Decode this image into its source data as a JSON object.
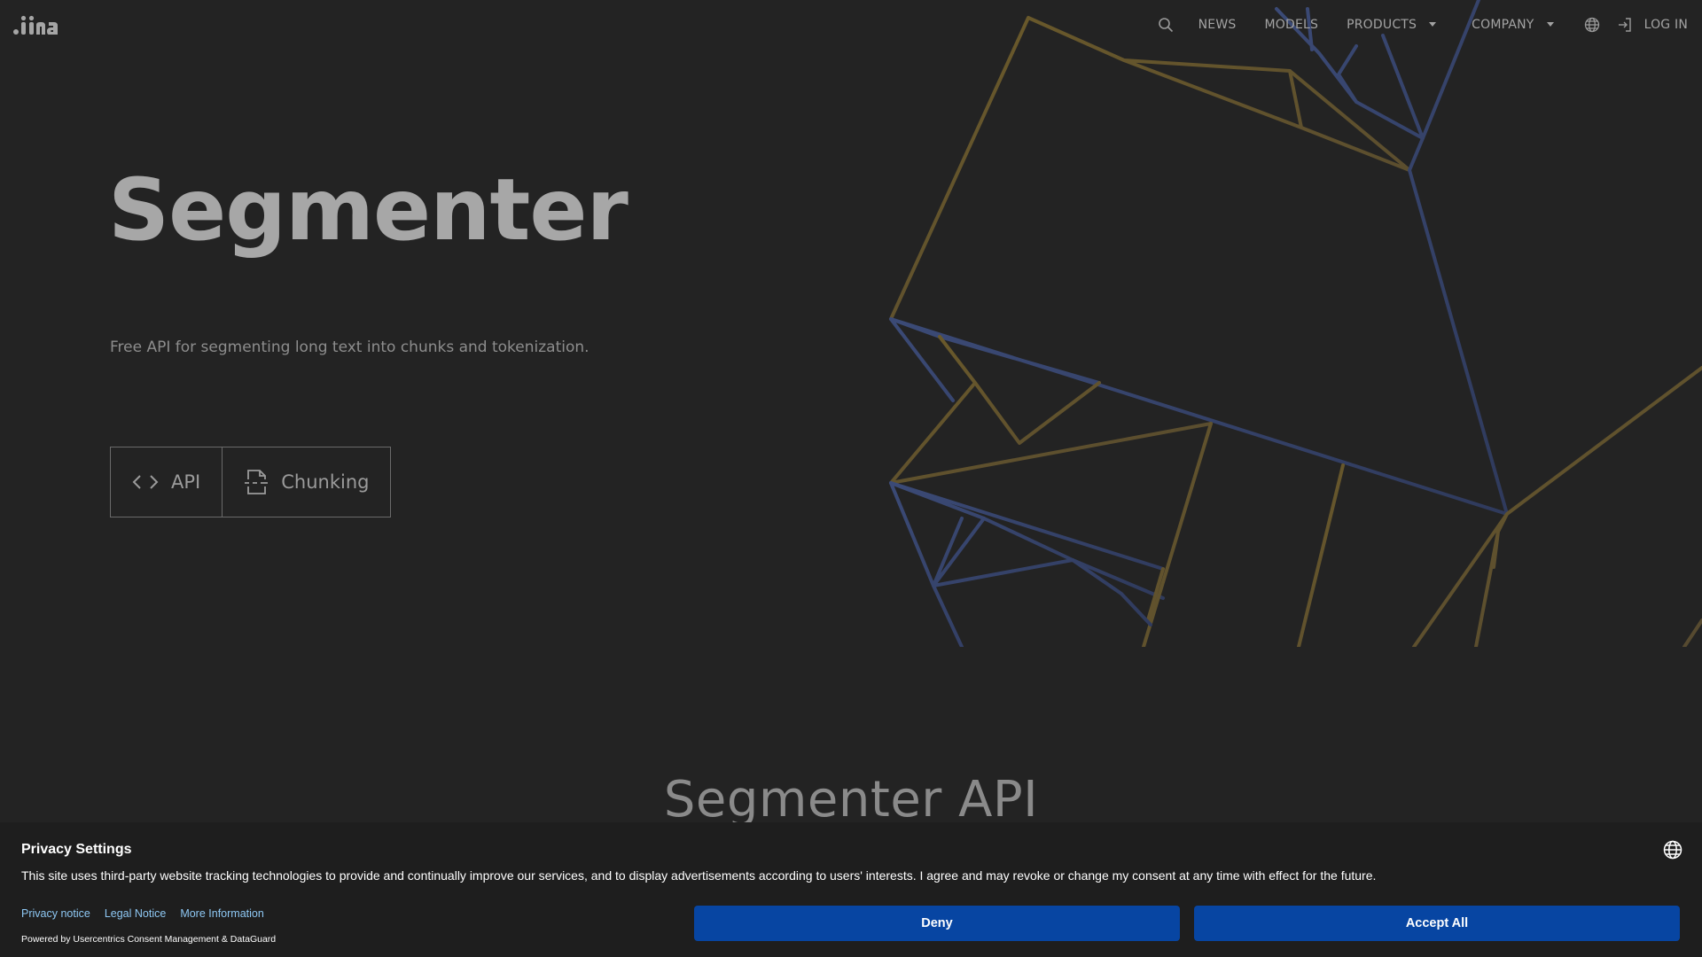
{
  "nav": {
    "links": {
      "news": "NEWS",
      "models": "MODELS",
      "products": "PRODUCTS",
      "company": "COMPANY",
      "login": "LOG IN"
    },
    "icons": [
      "search-icon",
      "globe-icon",
      "login-icon"
    ]
  },
  "hero": {
    "title": "Segmenter",
    "subtitle": "Free API for segmenting long text into chunks and tokenization.",
    "buttons": {
      "api": "API",
      "chunking": "Chunking"
    }
  },
  "section": {
    "title": "Segmenter API"
  },
  "consent": {
    "title": "Privacy Settings",
    "text": "This site uses third-party website tracking technologies to provide and continually improve our services, and to display advertisements according to users' interests. I agree and may revoke or change my consent at any time with effect for the future.",
    "links": {
      "privacy": "Privacy notice",
      "legal": "Legal Notice",
      "more": "More Information"
    },
    "powered_by": "Powered by Usercentrics Consent Management & DataGuard",
    "deny": "Deny",
    "accept": "Accept All"
  },
  "colors": {
    "background": "#232323",
    "consent_button": "#0745a2",
    "link": "#8ec8f4",
    "art_gold": "#6b5a2a",
    "art_blue": "#3d4d7a"
  }
}
